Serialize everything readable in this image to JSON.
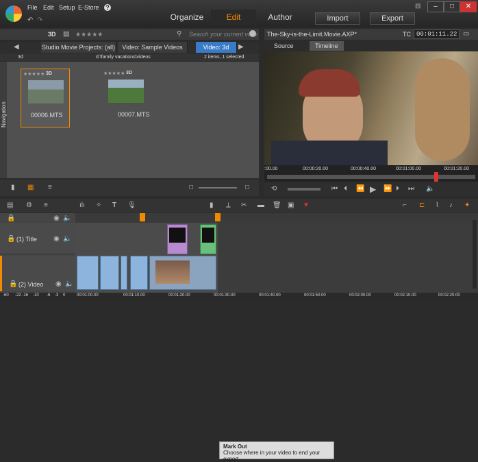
{
  "menu": {
    "file": "File",
    "edit": "Edit",
    "setup": "Setup",
    "estore": "E-Store",
    "help": "?"
  },
  "modes": {
    "organize": "Organize",
    "edit": "Edit",
    "author": "Author",
    "import": "Import",
    "export": "Export"
  },
  "window": {
    "min": "–",
    "max": "□",
    "close": "✕"
  },
  "library": {
    "header_3d": "3D",
    "rating": "★★★★★",
    "search_placeholder": "Search your current view",
    "tabs": [
      "Studio Movie Projects: (all)",
      "Video: Sample Videos",
      "Video: 3d"
    ],
    "path_left": "3d",
    "path": "d:\\family vacations\\videos",
    "summary": "2 items, 1 selected",
    "items": [
      {
        "name": "00006.MTS",
        "rating": "★★★★★",
        "tag": "3D"
      },
      {
        "name": "00007.MTS",
        "rating": "★★★★★",
        "tag": "3D"
      }
    ],
    "navigation": "Navigation"
  },
  "player": {
    "title": "The-Sky-is-the-Limit.Movie.AXP*",
    "tc_label": "TC",
    "timecode": "00:01:11.22",
    "tabs": [
      "Source",
      "Timeline"
    ],
    "ruler": [
      ":00.00",
      "00:00:20.00",
      "00:00:40.00",
      "00:01:00.00",
      "00:01:20.00"
    ]
  },
  "timeline": {
    "tracks": [
      "(1) Title",
      "(2) Video"
    ],
    "tooltip_title": "Mark Out",
    "tooltip_text": "Choose where in your video to end your export.",
    "ruler": [
      "-60",
      "-22 -16",
      "-10",
      "-6",
      "-3",
      "0",
      "00:01:00.00",
      "00:01:10.00",
      "00:01:20.00",
      "00:01:30.00",
      "00:01:40.00",
      "00:01:50.00",
      "00:02:00.00",
      "00:02:10.00",
      "00:02:20.00"
    ]
  },
  "colors": {
    "accent": "#f08a00",
    "edit_tab": "#ff8c00",
    "timecode": "#dcdcdc"
  }
}
